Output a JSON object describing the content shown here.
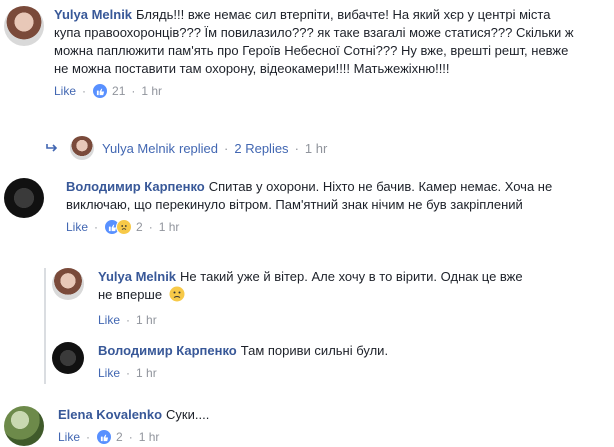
{
  "comments": [
    {
      "author": "Yulya Melnik",
      "text": "Блядь!!! вже немає сил втерпіти, вибачте! На який хєр у центрі міста купа правоохоронців??? Їм повилазило??? як таке взагалі може статися??? Скільки ж можна паплюжити пам'ять про Героїв Небесної Сотні??? Ну вже, врешті решт, невже не можна поставити там охорону, відеокамери!!!! Матьжежіхню!!!!",
      "like_label": "Like",
      "reaction_count": "21",
      "time": "1 hr"
    },
    {
      "author": "Володимир Карпенко",
      "text": "Спитав у охорони. Ніхто не бачив. Камер немає. Хоча не виключаю, що перекинуло вітром. Пам'ятний знак нічим не був закріплений",
      "like_label": "Like",
      "reaction_count": "2",
      "time": "1 hr"
    },
    {
      "author": "Elena Kovalenko",
      "text": "Суки....",
      "like_label": "Like",
      "reaction_count": "2",
      "time": "1 hr"
    }
  ],
  "replied_summary": {
    "author": "Yulya Melnik",
    "action": "replied",
    "replies": "2 Replies",
    "time": "1 hr"
  },
  "replies": [
    {
      "author": "Yulya Melnik",
      "text": "Не такий уже й вітер. Але хочу в то вірити. Однак це вже не вперше",
      "like_label": "Like",
      "time": "1 hr"
    },
    {
      "author": "Володимир Карпенко",
      "text": "Там пориви сильні були.",
      "like_label": "Like",
      "time": "1 hr"
    }
  ],
  "separator": "·"
}
